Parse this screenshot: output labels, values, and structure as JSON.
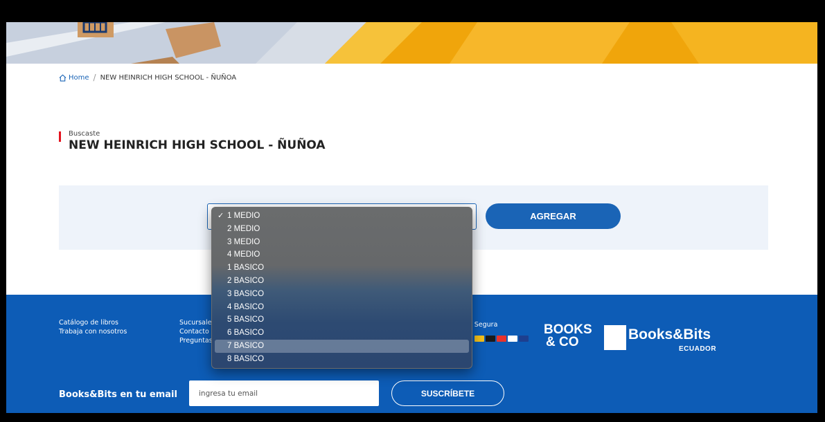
{
  "breadcrumb": {
    "home": "Home",
    "current": "NEW HEINRICH HIGH SCHOOL - ÑUÑOA"
  },
  "search": {
    "label": "Buscaste",
    "title": "NEW HEINRICH HIGH SCHOOL - ÑUÑOA"
  },
  "form": {
    "selected": "1 MEDIO",
    "options": [
      "1 MEDIO",
      "2 MEDIO",
      "3 MEDIO",
      "4 MEDIO",
      "1 BASICO",
      "2 BASICO",
      "3 BASICO",
      "4 BASICO",
      "5 BASICO",
      "6 BASICO",
      "7 BASICO",
      "8 BASICO"
    ],
    "highlighted": "7 BASICO",
    "add_label": "AGREGAR"
  },
  "footer": {
    "col1": [
      "Catálogo de libros",
      "Trabaja con nosotros"
    ],
    "col2": [
      "Sucursale",
      "Contacto",
      "Preguntas"
    ],
    "payment_label": "ra Segura",
    "brand1_line1": "BOOKS",
    "brand1_line2": "& CO",
    "brand2_name": "Books&Bits",
    "brand2_sub": "ECUADOR",
    "newsletter_label": "Books&Bits en tu email",
    "email_placeholder": "ingresa tu email",
    "subscribe_label": "SUSCRÍBETE"
  },
  "colors": {
    "primary": "#1a64b6",
    "footer": "#0d5cb6",
    "accent": "#e4141f",
    "banner": "#f3a60a"
  },
  "icons": [
    "home-icon",
    "check-icon",
    "cart-icon"
  ]
}
